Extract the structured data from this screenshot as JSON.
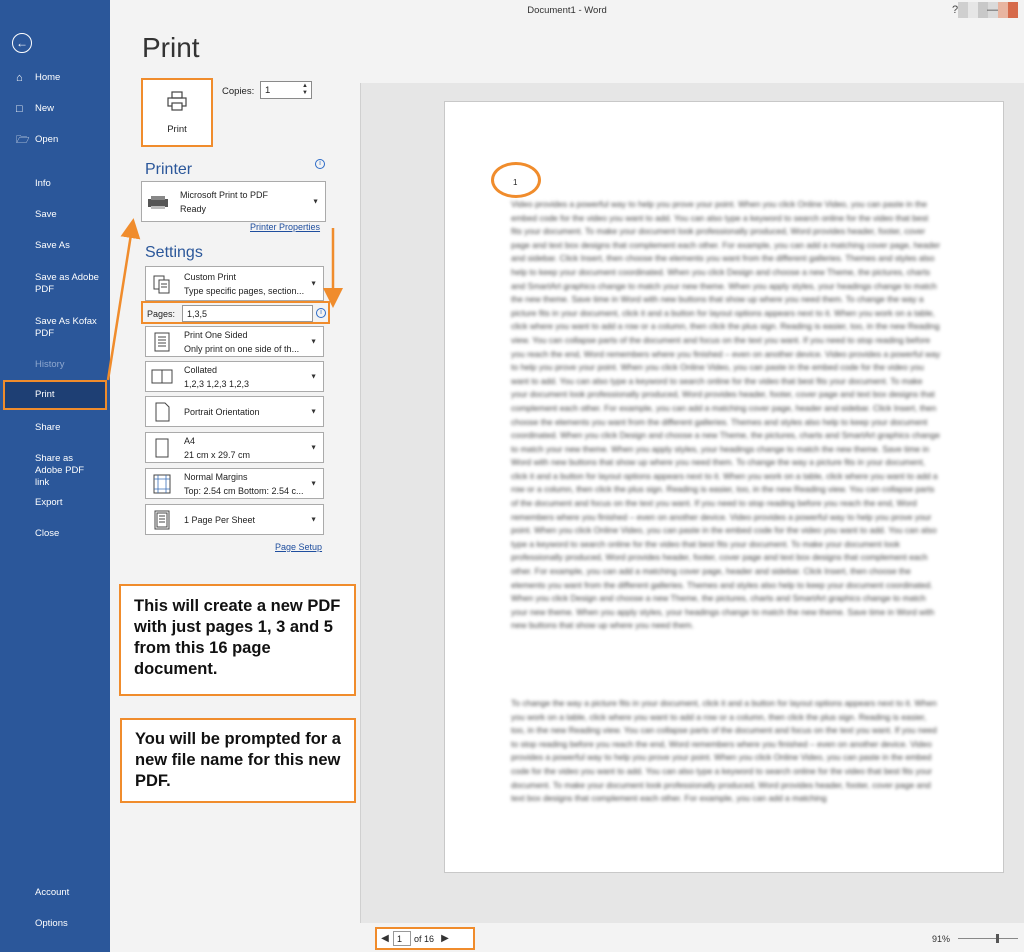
{
  "window": {
    "title": "Document1  -  Word",
    "help_label": "?",
    "minimize_label": "—"
  },
  "sidebar": {
    "back_icon": "back-arrow-icon",
    "items": [
      {
        "label": "Home",
        "icon": "home-icon"
      },
      {
        "label": "New",
        "icon": "new-document-icon"
      },
      {
        "label": "Open",
        "icon": "folder-open-icon"
      },
      {
        "label": "Info"
      },
      {
        "label": "Save"
      },
      {
        "label": "Save As"
      },
      {
        "label": "Save as Adobe PDF"
      },
      {
        "label": "Save As Kofax PDF"
      },
      {
        "label": "History"
      },
      {
        "label": "Print"
      },
      {
        "label": "Share"
      },
      {
        "label": "Share as Adobe PDF link"
      },
      {
        "label": "Export"
      },
      {
        "label": "Close"
      },
      {
        "label": "Account"
      },
      {
        "label": "Options"
      }
    ]
  },
  "print": {
    "page_title": "Print",
    "print_button_label": "Print",
    "copies_label": "Copies:",
    "copies_value": "1",
    "printer_heading": "Printer",
    "printer_name": "Microsoft Print to PDF",
    "printer_status": "Ready",
    "printer_properties_link": "Printer Properties",
    "settings_heading": "Settings",
    "settings": [
      {
        "line1": "Custom Print",
        "line2": "Type specific pages, section..."
      },
      {
        "line1": "Print One Sided",
        "line2": "Only print on one side of th..."
      },
      {
        "line1": "Collated",
        "line2": "1,2,3    1,2,3    1,2,3"
      },
      {
        "line1": "Portrait Orientation",
        "line2": ""
      },
      {
        "line1": "A4",
        "line2": "21 cm x 29.7 cm"
      },
      {
        "line1": "Normal Margins",
        "line2": "Top: 2.54 cm Bottom: 2.54 c..."
      },
      {
        "line1": "1 Page Per Sheet",
        "line2": ""
      }
    ],
    "pages_label": "Pages:",
    "pages_value": "1,3,5",
    "page_setup_link": "Page Setup"
  },
  "callouts": {
    "first": "This will create a new PDF with just pages 1, 3 and 5 from this 16 page document.",
    "second": "You will be prompted for a new file name for this new PDF."
  },
  "preview": {
    "page_number": "1",
    "paragraph1": "Video provides a powerful way to help you prove your point. When you click Online Video, you can paste in the embed code for the video you want to add. You can also type a keyword to search online for the video that best fits your document. To make your document look professionally produced, Word provides header, footer, cover page and text box designs that complement each other. For example, you can add a matching cover page, header and sidebar. Click Insert, then choose the elements you want from the different galleries. Themes and styles also help to keep your document coordinated. When you click Design and choose a new Theme, the pictures, charts and SmartArt graphics change to match your new theme. When you apply styles, your headings change to match the new theme. Save time in Word with new buttons that show up where you need them. To change the way a picture fits in your document, click it and a button for layout options appears next to it. When you work on a table, click where you want to add a row or a column, then click the plus sign. Reading is easier, too, in the new Reading view. You can collapse parts of the document and focus on the text you want. If you need to stop reading before you reach the end, Word remembers where you finished – even on another device. Video provides a powerful way to help you prove your point. When you click Online Video, you can paste in the embed code for the video you want to add. You can also type a keyword to search online for the video that best fits your document. To make your document look professionally produced, Word provides header, footer, cover page and text box designs that complement each other. For example, you can add a matching cover page, header and sidebar. Click Insert, then choose the elements you want from the different galleries. Themes and styles also help to keep your document coordinated. When you click Design and choose a new Theme, the pictures, charts and SmartArt graphics change to match your new theme. When you apply styles, your headings change to match the new theme. Save time in Word with new buttons that show up where you need them. To change the way a picture fits in your document, click it and a button for layout options appears next to it. When you work on a table, click where you want to add a row or a column, then click the plus sign. Reading is easier, too, in the new Reading view. You can collapse parts of the document and focus on the text you want. If you need to stop reading before you reach the end, Word remembers where you finished – even on another device. Video provides a powerful way to help you prove your point. When you click Online Video, you can paste in the embed code for the video you want to add. You can also type a keyword to search online for the video that best fits your document. To make your document look professionally produced, Word provides header, footer, cover page and text box designs that complement each other. For example, you can add a matching cover page, header and sidebar. Click Insert, then choose the elements you want from the different galleries. Themes and styles also help to keep your document coordinated. When you click Design and choose a new Theme, the pictures, charts and SmartArt graphics change to match your new theme. When you apply styles, your headings change to match the new theme. Save time in Word with new buttons that show up where you need them.",
    "paragraph2": "To change the way a picture fits in your document, click it and a button for layout options appears next to it. When you work on a table, click where you want to add a row or a column, then click the plus sign. Reading is easier, too, in the new Reading view. You can collapse parts of the document and focus on the text you want. If you need to stop reading before you reach the end, Word remembers where you finished – even on another device. Video provides a powerful way to help you prove your point. When you click Online Video, you can paste in the embed code for the video you want to add. You can also type a keyword to search online for the video that best fits your document. To make your document look professionally produced, Word provides header, footer, cover page and text box designs that complement each other. For example, you can add a matching",
    "current_page": "1",
    "of_pages": "of 16",
    "zoom": "91%"
  },
  "colors": {
    "sidebar": "#2b579a",
    "sidebar_selected": "#1e3f74",
    "highlight": "#f08c2c",
    "heading": "#2b579a"
  }
}
